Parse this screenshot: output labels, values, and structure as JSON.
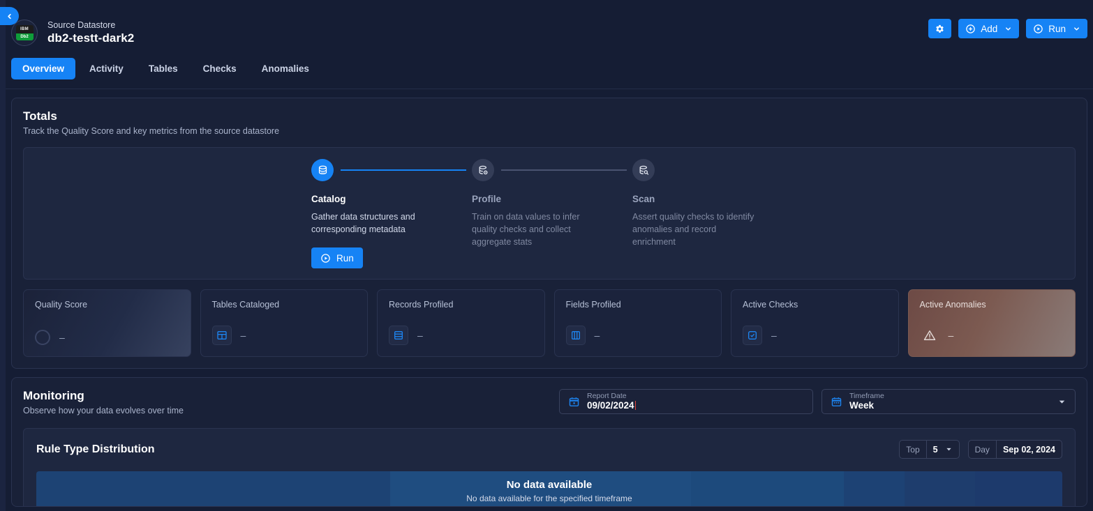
{
  "colors": {
    "accent": "#1683f5",
    "page_bg": "#151d34",
    "panel_bg": "#192138",
    "anomaly_gradient_start": "#6d4a45",
    "anomaly_gradient_end": "#8a7b78"
  },
  "nav": {
    "back_icon": "chevron-left-icon"
  },
  "header": {
    "kind": "Source Datastore",
    "name": "db2-testt-dark2",
    "logo": {
      "top": "IBM",
      "bottom": "Db2"
    },
    "actions": {
      "settings_icon": "gear-icon",
      "add_label": "Add",
      "add_icon": "plus-circle-icon",
      "run_label": "Run",
      "run_icon": "play-circle-icon",
      "caret_icon": "chevron-down-icon"
    },
    "tabs": [
      {
        "label": "Overview",
        "active": true
      },
      {
        "label": "Activity",
        "active": false
      },
      {
        "label": "Tables",
        "active": false
      },
      {
        "label": "Checks",
        "active": false
      },
      {
        "label": "Anomalies",
        "active": false
      }
    ]
  },
  "totals": {
    "title": "Totals",
    "subtitle": "Track the Quality Score and key metrics from the source datastore",
    "steps": [
      {
        "name": "Catalog",
        "desc": "Gather data structures and corresponding metadata",
        "state": "active",
        "icon": "database-icon"
      },
      {
        "name": "Profile",
        "desc": "Train on data values to infer quality checks and collect aggregate stats",
        "state": "idle",
        "icon": "database-gear-icon"
      },
      {
        "name": "Scan",
        "desc": "Assert quality checks to identify anomalies and record enrichment",
        "state": "idle",
        "icon": "database-search-icon"
      }
    ],
    "run_button": {
      "label": "Run",
      "icon": "play-circle-icon"
    },
    "metrics": [
      {
        "label": "Quality Score",
        "value": "–",
        "icon": "score-ring-icon",
        "style": "quality"
      },
      {
        "label": "Tables Cataloged",
        "value": "–",
        "icon": "table-icon",
        "style": "default"
      },
      {
        "label": "Records Profiled",
        "value": "–",
        "icon": "rows-icon",
        "style": "default"
      },
      {
        "label": "Fields Profiled",
        "value": "–",
        "icon": "columns-icon",
        "style": "default"
      },
      {
        "label": "Active Checks",
        "value": "–",
        "icon": "check-square-icon",
        "style": "default"
      },
      {
        "label": "Active Anomalies",
        "value": "–",
        "icon": "warning-triangle-icon",
        "style": "anomalies"
      }
    ]
  },
  "monitoring": {
    "title": "Monitoring",
    "subtitle": "Observe how your data evolves over time",
    "report_date": {
      "label": "Report Date",
      "value": "09/02/2024",
      "icon": "calendar-icon"
    },
    "timeframe": {
      "label": "Timeframe",
      "value": "Week",
      "icon": "calendar-range-icon",
      "caret": "chevron-down-icon"
    }
  },
  "chart_data": {
    "type": "bar",
    "title": "Rule Type Distribution",
    "categories": [],
    "values": [],
    "series": [],
    "empty_state": {
      "title": "No data available",
      "subtitle": "No data available for the specified timeframe"
    },
    "controls": {
      "top": {
        "key": "Top",
        "value": "5",
        "caret": "chevron-down-icon"
      },
      "day": {
        "key": "Day",
        "value": "Sep 02, 2024"
      }
    },
    "placeholder_segments": [
      {
        "width_pct": 34.5,
        "color": "#1d4374"
      },
      {
        "width_pct": 29.3,
        "color": "#1f4d80"
      },
      {
        "width_pct": 14.9,
        "color": "#1d4a7c"
      },
      {
        "width_pct": 5.9,
        "color": "#1d4274"
      },
      {
        "width_pct": 6.9,
        "color": "#1e3d6d"
      },
      {
        "width_pct": 8.5,
        "color": "#1d3a6c"
      }
    ]
  }
}
